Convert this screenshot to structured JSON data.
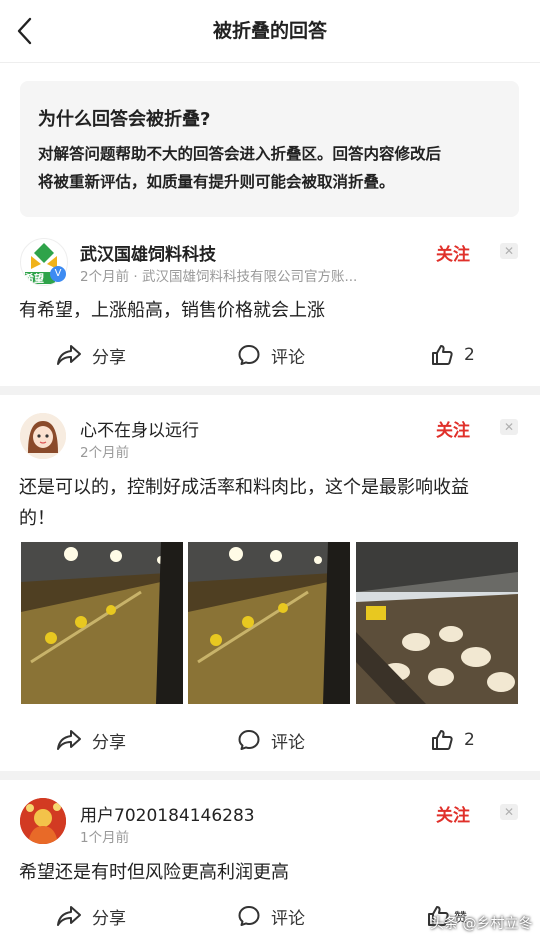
{
  "navbar": {
    "title": "被折叠的回答"
  },
  "notice": {
    "title": "为什么回答会被折叠?",
    "body_line1": "对解答问题帮助不大的回答会进入折叠区。回答内容修改后",
    "body_line2": "将被重新评估，如质量有提升则可能会被取消折叠。"
  },
  "answers": [
    {
      "author": "武汉国雄饲料科技",
      "meta": "2个月前 · 武汉国雄饲料科技有限公司官方账...",
      "avatar_text": "希望",
      "follow": "关注",
      "content": "有希望，上涨船高，销售价格就会上涨",
      "share": "分享",
      "comment": "评论",
      "likes": "2"
    },
    {
      "author": "心不在身以远行",
      "meta": "2个月前",
      "follow": "关注",
      "content_line1": "还是可以的，控制好成活率和料肉比，这个是最影响收益",
      "content_line2": "的！",
      "share": "分享",
      "comment": "评论",
      "likes": "2"
    },
    {
      "author": "用户7020184146283",
      "meta": "1个月前",
      "follow": "关注",
      "content": "希望还是有时但风险更高利润更高",
      "share": "分享",
      "comment": "评论",
      "likes": "赞"
    }
  ],
  "watermark": "头条 @乡村立冬",
  "colors": {
    "accent": "#e0302a",
    "meta": "#999999",
    "divider": "#f2f2f2"
  }
}
